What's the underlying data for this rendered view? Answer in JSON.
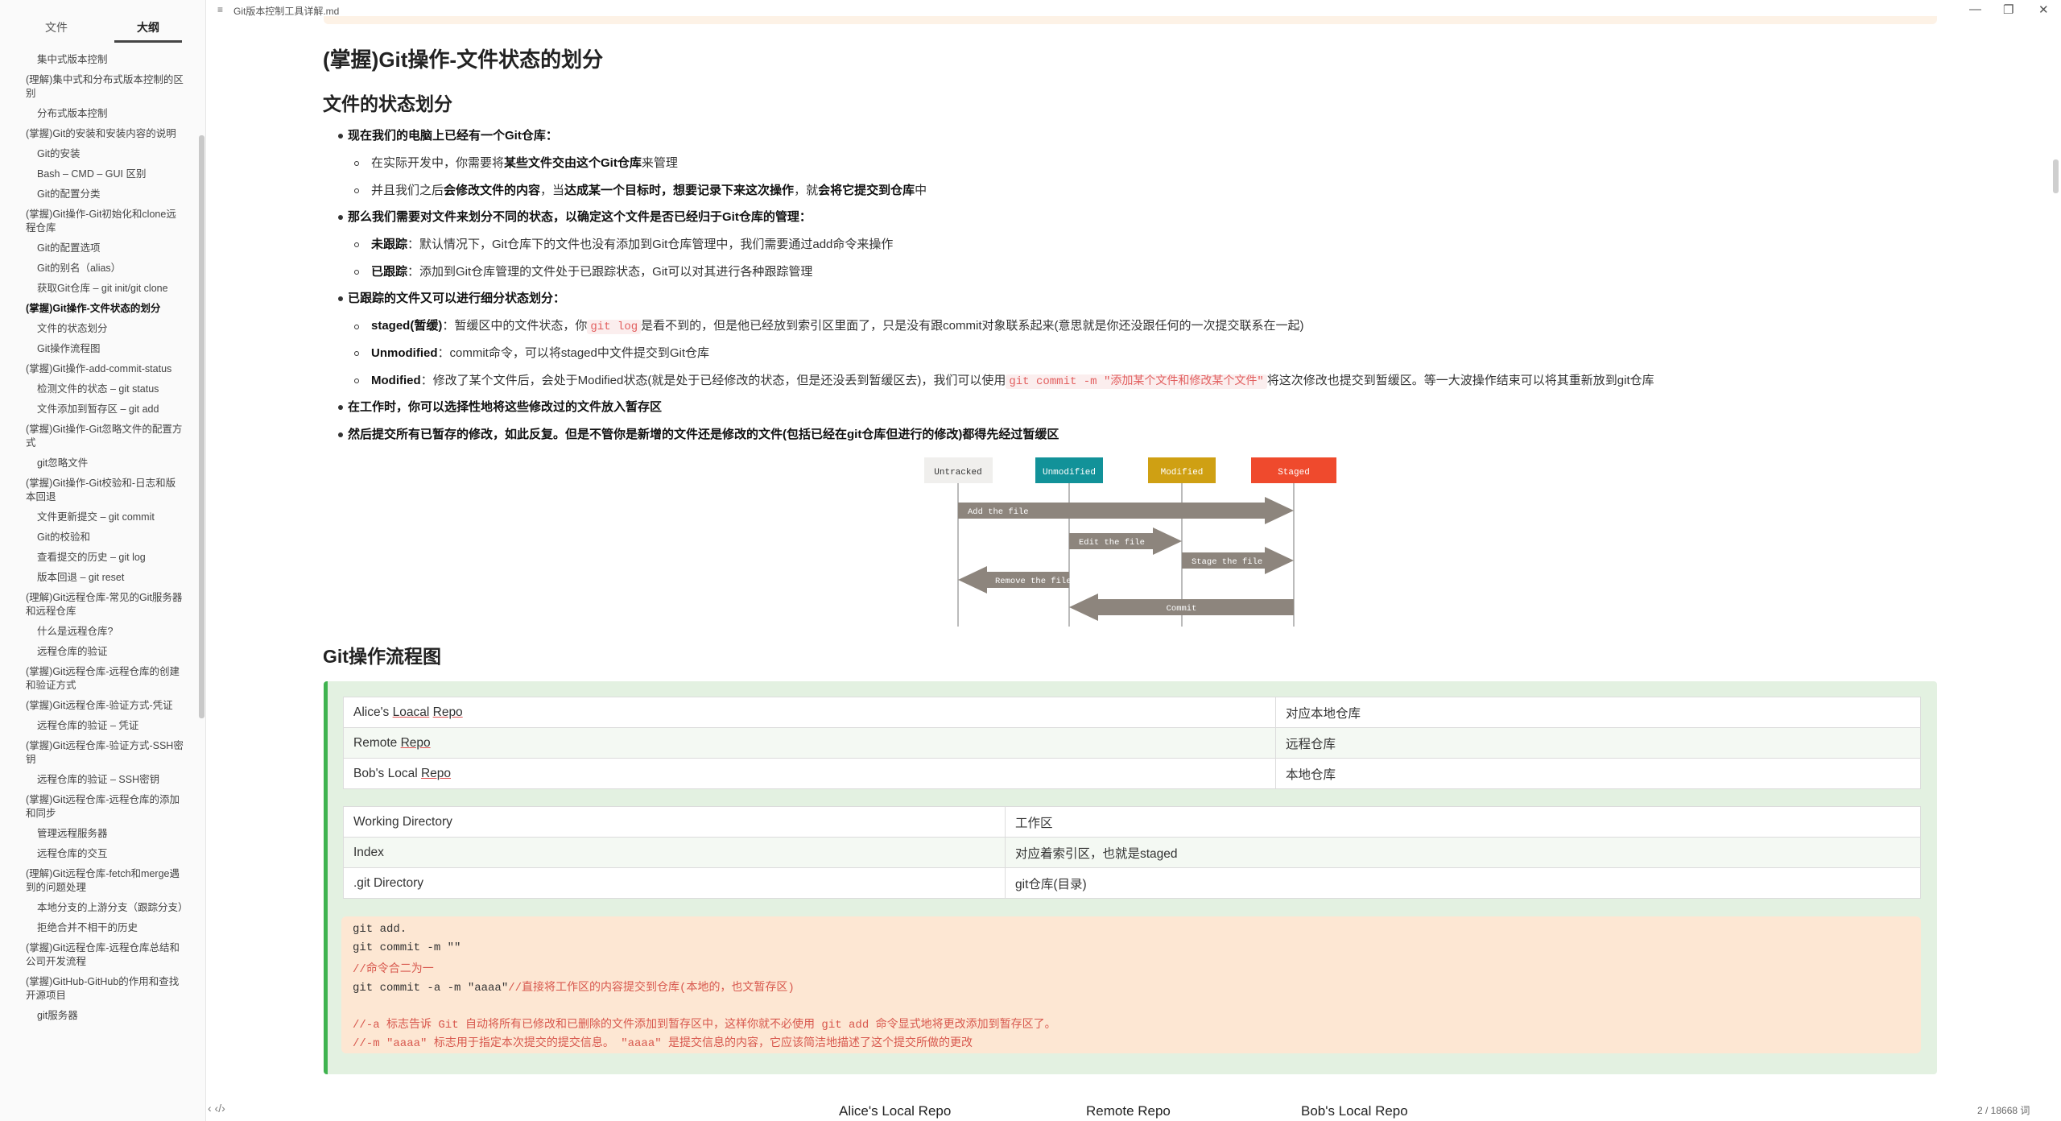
{
  "window": {
    "title": "Git版本控制工具详解.md",
    "doc_icon": "≡",
    "minimize": "—",
    "restore": "❐",
    "close": "✕"
  },
  "sidebar": {
    "tabs": [
      "文件",
      "大纲"
    ],
    "active_tab": "大纲",
    "items": [
      {
        "label": "集中式版本控制",
        "level": 2
      },
      {
        "label": "(理解)集中式和分布式版本控制的区别",
        "level": 1
      },
      {
        "label": "分布式版本控制",
        "level": 2
      },
      {
        "label": "(掌握)Git的安装和安装内容的说明",
        "level": 1
      },
      {
        "label": "Git的安装",
        "level": 2
      },
      {
        "label": "Bash – CMD – GUI 区别",
        "level": 2
      },
      {
        "label": "Git的配置分类",
        "level": 2
      },
      {
        "label": "(掌握)Git操作-Git初始化和clone远程仓库",
        "level": 1
      },
      {
        "label": "Git的配置选项",
        "level": 2
      },
      {
        "label": "Git的别名（alias）",
        "level": 2
      },
      {
        "label": "获取Git仓库 – git init/git clone",
        "level": 2
      },
      {
        "label": "(掌握)Git操作-文件状态的划分",
        "level": 1,
        "active": true
      },
      {
        "label": "文件的状态划分",
        "level": 2
      },
      {
        "label": "Git操作流程图",
        "level": 2
      },
      {
        "label": "(掌握)Git操作-add-commit-status",
        "level": 1
      },
      {
        "label": "检测文件的状态 – git status",
        "level": 2
      },
      {
        "label": "文件添加到暂存区 – git add",
        "level": 2
      },
      {
        "label": "(掌握)Git操作-Git忽略文件的配置方式",
        "level": 1
      },
      {
        "label": "git忽略文件",
        "level": 2
      },
      {
        "label": "(掌握)Git操作-Git校验和-日志和版本回退",
        "level": 1
      },
      {
        "label": "文件更新提交 – git commit",
        "level": 2
      },
      {
        "label": "Git的校验和",
        "level": 2
      },
      {
        "label": "查看提交的历史 – git log",
        "level": 2
      },
      {
        "label": "版本回退 – git reset",
        "level": 2
      },
      {
        "label": "(理解)Git远程仓库-常见的Git服务器和远程仓库",
        "level": 1
      },
      {
        "label": "什么是远程仓库?",
        "level": 2
      },
      {
        "label": "远程仓库的验证",
        "level": 2
      },
      {
        "label": "(掌握)Git远程仓库-远程仓库的创建和验证方式",
        "level": 1
      },
      {
        "label": "(掌握)Git远程仓库-验证方式-凭证",
        "level": 1
      },
      {
        "label": "远程仓库的验证 – 凭证",
        "level": 2
      },
      {
        "label": "(掌握)Git远程仓库-验证方式-SSH密钥",
        "level": 1
      },
      {
        "label": "远程仓库的验证 – SSH密钥",
        "level": 2
      },
      {
        "label": "(掌握)Git远程仓库-远程仓库的添加和同步",
        "level": 1
      },
      {
        "label": "管理远程服务器",
        "level": 2
      },
      {
        "label": "远程仓库的交互",
        "level": 2
      },
      {
        "label": "(理解)Git远程仓库-fetch和merge遇到的问题处理",
        "level": 1
      },
      {
        "label": "本地分支的上游分支（跟踪分支）",
        "level": 2
      },
      {
        "label": "拒绝合并不相干的历史",
        "level": 2
      },
      {
        "label": "(掌握)Git远程仓库-远程仓库总结和公司开发流程",
        "level": 1
      },
      {
        "label": "(掌握)GitHub-GitHub的作用和查找开源项目",
        "level": 1
      },
      {
        "label": "git服务器",
        "level": 2
      }
    ],
    "bottom_icons": "‹   ‹/›"
  },
  "content": {
    "h1": "(掌握)Git操作-文件状态的划分",
    "h2_states": "文件的状态划分",
    "b1": "现在我们的电脑上已经有一个Git仓库：",
    "b1_1_pre": "在实际开发中，你需要将",
    "b1_1_bold": "某些文件交由这个Git仓库",
    "b1_1_post": "来管理",
    "b1_2_pre": "并且我们之后",
    "b1_2_bold1": "会修改文件的内容",
    "b1_2_mid": "，当",
    "b1_2_bold2": "达成某一个目标时，想要记录下来这次操作",
    "b1_2_mid2": "，就",
    "b1_2_bold3": "会将它提交到仓库",
    "b1_2_post": "中",
    "b2": "那么我们需要对文件来划分不同的状态，以确定这个文件是否已经归于Git仓库的管理：",
    "b2_1_bold": "未跟踪",
    "b2_1_text": "：默认情况下，Git仓库下的文件也没有添加到Git仓库管理中，我们需要通过add命令来操作",
    "b2_2_bold": "已跟踪",
    "b2_2_text": "：添加到Git仓库管理的文件处于已跟踪状态，Git可以对其进行各种跟踪管理",
    "b3": "已跟踪的文件又可以进行细分状态划分：",
    "b3_1_bold": "staged(暂缓)",
    "b3_1_pre": "：暂缓区中的文件状态，你",
    "b3_1_code": "git log",
    "b3_1_post": "是看不到的，但是他已经放到索引区里面了，只是没有跟commit对象联系起来(意思就是你还没跟任何的一次提交联系在一起)",
    "b3_2_bold": "Unmodified",
    "b3_2_text": "：commit命令，可以将staged中文件提交到Git仓库",
    "b3_3_bold": "Modified",
    "b3_3_pre": "：修改了某个文件后，会处于Modified状态(就是处于已经修改的状态，但是还没丢到暂缓区去)，我们可以使用",
    "b3_3_code": "git commit -m \"添加某个文件和修改某个文件\"",
    "b3_3_post": "将这次修改也提交到暂缓区。等一大波操作结束可以将其重新放到git仓库",
    "b4": "在工作时，你可以选择性地将这些修改过的文件放入暂存区",
    "b5": "然后提交所有已暂存的修改，如此反复。但是不管你是新增的文件还是修改的文件(包括已经在git仓库但进行的修改)都得先经过暂缓区",
    "h2_flow": "Git操作流程图"
  },
  "diagram": {
    "states": [
      {
        "label": "Untracked",
        "color": "#f0efed",
        "text_color": "#333"
      },
      {
        "label": "Unmodified",
        "color": "#129299",
        "text_color": "#fff"
      },
      {
        "label": "Modified",
        "color": "#cfa013",
        "text_color": "#fff"
      },
      {
        "label": "Staged",
        "color": "#ef4a2d",
        "text_color": "#fff"
      }
    ],
    "arrows": [
      "Add the file",
      "Edit the file",
      "Stage the file",
      "Remove the file",
      "Commit"
    ],
    "arrow_color": "#8d857d"
  },
  "table1": [
    [
      "Alice's Loacal Repo",
      "对应本地仓库"
    ],
    [
      "Remote Repo",
      "远程仓库"
    ],
    [
      "Bob's Local Repo",
      "本地仓库"
    ]
  ],
  "table2": [
    [
      "Working Directory",
      "工作区"
    ],
    [
      "Index",
      "对应着索引区，也就是staged"
    ],
    [
      ".git Directory",
      "git仓库(目录)"
    ]
  ],
  "code": {
    "l1": "git add.",
    "l2": "git commit -m \"\"",
    "l3": "//命令合二为一",
    "l4_cmd": "git commit -a -m \"aaaa\"",
    "l4_cmt": "//直接将工作区的内容提交到仓库(本地的，也文暂存区)",
    "l5": "//-a 标志告诉 Git 自动将所有已修改和已删除的文件添加到暂存区中，这样你就不必使用 git add 命令显式地将更改添加到暂存区了。",
    "l6": "//-m \"aaaa\" 标志用于指定本次提交的提交信息。 \"aaaa\" 是提交信息的内容，它应该简洁地描述了这个提交所做的更改"
  },
  "bottom_labels": [
    "Alice's Local Repo",
    "Remote Repo",
    "Bob's Local Repo"
  ],
  "status": {
    "word_count": "2 / 18668 词"
  }
}
